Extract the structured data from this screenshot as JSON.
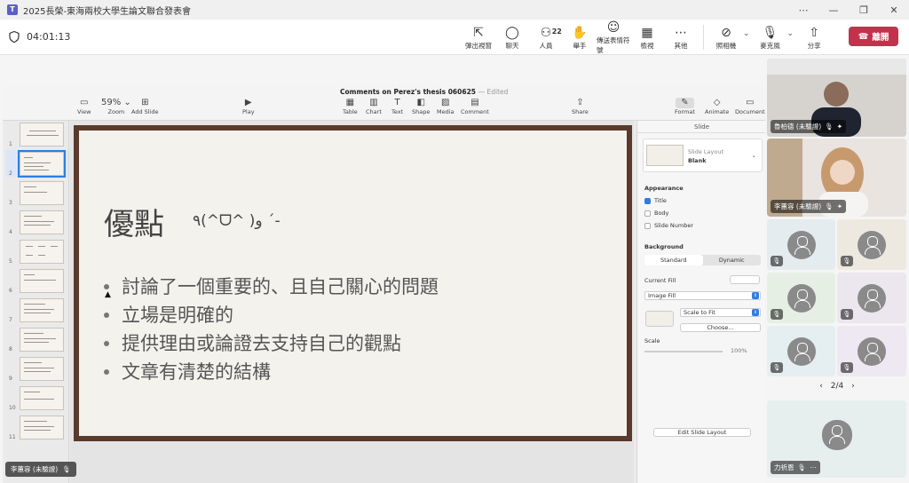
{
  "window": {
    "title": "2025長榮-東海兩校大學生論文聯合發表會",
    "controls": [
      "⋯",
      "—",
      "❐",
      "✕"
    ]
  },
  "meeting": {
    "timer": "04:01:13",
    "tools": [
      {
        "icon": "pop-out-icon",
        "glyph": "⇱",
        "label": "彈出視窗"
      },
      {
        "icon": "chat-icon",
        "glyph": "💬",
        "label": "聊天"
      },
      {
        "icon": "people-icon",
        "glyph": "👤",
        "label": "人員",
        "count": "22"
      },
      {
        "icon": "raise-hand-icon",
        "glyph": "✋",
        "label": "舉手"
      },
      {
        "icon": "reactions-icon",
        "glyph": "☺",
        "label": "傳送表情符號"
      },
      {
        "icon": "view-icon",
        "glyph": "▦",
        "label": "檢視"
      },
      {
        "icon": "more-icon",
        "glyph": "⋯",
        "label": "其他"
      }
    ],
    "camera_label": "照相機",
    "mic_label": "麥克風",
    "share_label": "分享",
    "leave_label": "離開"
  },
  "keynote": {
    "doc_title": "Comments on Perez's thesis 060625",
    "edited": "— Edited",
    "toolbar": [
      {
        "name": "view",
        "glyph": "▭",
        "label": "View"
      },
      {
        "name": "zoom",
        "glyph": "59% ⌄",
        "label": "Zoom"
      },
      {
        "name": "add-slide",
        "glyph": "⊞",
        "label": "Add Slide"
      },
      {
        "name": "play",
        "glyph": "▶",
        "label": "Play"
      },
      {
        "name": "table",
        "glyph": "▦",
        "label": "Table"
      },
      {
        "name": "chart",
        "glyph": "▥",
        "label": "Chart"
      },
      {
        "name": "text",
        "glyph": "T",
        "label": "Text"
      },
      {
        "name": "shape",
        "glyph": "◧",
        "label": "Shape"
      },
      {
        "name": "media",
        "glyph": "▨",
        "label": "Media"
      },
      {
        "name": "comment",
        "glyph": "▤",
        "label": "Comment"
      },
      {
        "name": "share",
        "glyph": "⇪",
        "label": "Share"
      },
      {
        "name": "format",
        "glyph": "✎",
        "label": "Format"
      },
      {
        "name": "animate",
        "glyph": "◇",
        "label": "Animate"
      },
      {
        "name": "document",
        "glyph": "▭",
        "label": "Document"
      }
    ],
    "slide_numbers": [
      "1",
      "2",
      "3",
      "4",
      "5",
      "6",
      "7",
      "8",
      "9",
      "10",
      "11"
    ],
    "selected_slide": "2",
    "slide": {
      "title": "優點",
      "kaomoji": "٩(^ᗜ^ )و ´-",
      "bullets": [
        "討論了一個重要的、且自己關心的問題",
        "立場是明確的",
        "提供理由或論證去支持自己的觀點",
        "文章有清楚的結構"
      ]
    },
    "inspector": {
      "header": "Slide",
      "layout_label": "Slide Layout",
      "layout_value": "Blank",
      "appearance": "Appearance",
      "checks": [
        {
          "label": "Title",
          "checked": true
        },
        {
          "label": "Body",
          "checked": false
        },
        {
          "label": "Slide Number",
          "checked": false
        }
      ],
      "background": "Background",
      "seg_standard": "Standard",
      "seg_dynamic": "Dynamic",
      "current_fill": "Current Fill",
      "fill_type": "Image Fill",
      "scale_mode": "Scale to Fit",
      "choose": "Choose...",
      "scale": "Scale",
      "scale_value": "100%",
      "edit_layout": "Edit Slide Layout"
    }
  },
  "participants": {
    "video1_name": "魯柏德 (未驗證)",
    "video2_name": "李蕙容 (未驗證)",
    "page": "2/4",
    "bottom_name": "力祈恩"
  },
  "self_label": "李蕙容 (未驗證)"
}
